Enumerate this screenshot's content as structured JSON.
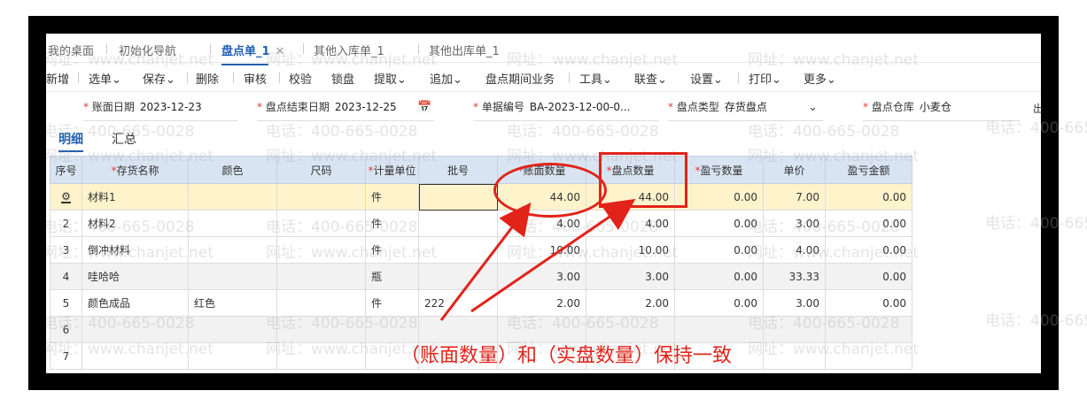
{
  "tabs": [
    {
      "label": "我的桌面"
    },
    {
      "label": "初始化导航"
    },
    {
      "label": "盘点单_1",
      "active": true
    },
    {
      "label": "其他入库单_1"
    },
    {
      "label": "其他出库单_1"
    }
  ],
  "tab_close_icon": "close-icon",
  "toolbar": [
    "新增",
    "选单⌄",
    "保存⌄",
    "删除",
    "审核",
    "校验",
    "锁盘",
    "提取⌄",
    "追加⌄",
    "盘点期间业务",
    "工具⌄",
    "联查⌄",
    "设置⌄",
    "打印⌄",
    "更多⌄"
  ],
  "form": {
    "book_date_label": "账面日期",
    "book_date_value": "2023-12-23",
    "end_date_label": "盘点结束日期",
    "end_date_value": "2023-12-25",
    "calendar_icon": "calendar-icon",
    "doc_no_label": "单据编号",
    "doc_no_value": "BA-2023-12-00-0...",
    "type_label": "盘点类型",
    "type_value": "存货盘点",
    "warehouse_label": "盘点仓库",
    "warehouse_value": "小麦仓",
    "cut_text": "出"
  },
  "detail_tabs": {
    "detail": "明细",
    "summary": "汇总"
  },
  "grid": {
    "columns": [
      "序号",
      "存货名称",
      "颜色",
      "尺码",
      "计量单位",
      "批号",
      "账面数量",
      "盘点数量",
      "盈亏数量",
      "单价",
      "盈亏金额"
    ],
    "required_columns": [
      "存货名称",
      "计量单位",
      "账面数量",
      "盘点数量",
      "盈亏数量"
    ],
    "row_settings_icon": "gear-icon",
    "rows": [
      {
        "no": "",
        "name": "材料1",
        "color": "",
        "size": "",
        "unit": "件",
        "batch": "",
        "book": "44.00",
        "count": "44.00",
        "diff": "0.00",
        "price": "7.00",
        "amount": "0.00"
      },
      {
        "no": "2",
        "name": "材料2",
        "color": "",
        "size": "",
        "unit": "件",
        "batch": "",
        "book": "4.00",
        "count": "4.00",
        "diff": "0.00",
        "price": "3.00",
        "amount": "0.00"
      },
      {
        "no": "3",
        "name": "倒冲材料",
        "color": "",
        "size": "",
        "unit": "件",
        "batch": "",
        "book": "10.00",
        "count": "10.00",
        "diff": "0.00",
        "price": "4.00",
        "amount": "0.00"
      },
      {
        "no": "4",
        "name": "哇哈哈",
        "color": "",
        "size": "",
        "unit": "瓶",
        "batch": "",
        "book": "3.00",
        "count": "3.00",
        "diff": "0.00",
        "price": "33.33",
        "amount": "0.00"
      },
      {
        "no": "5",
        "name": "颜色成品",
        "color": "红色",
        "size": "",
        "unit": "件",
        "batch": "222",
        "book": "2.00",
        "count": "2.00",
        "diff": "0.00",
        "price": "3.00",
        "amount": "0.00"
      },
      {
        "no": "6",
        "name": "",
        "color": "",
        "size": "",
        "unit": "",
        "batch": "",
        "book": "",
        "count": "",
        "diff": "",
        "price": "",
        "amount": ""
      },
      {
        "no": "7",
        "name": "",
        "color": "",
        "size": "",
        "unit": "",
        "batch": "",
        "book": "",
        "count": "",
        "diff": "",
        "price": "",
        "amount": ""
      }
    ]
  },
  "watermark": {
    "phone": "电话：400-665-0028",
    "site": "网址：www.chanjet.net"
  },
  "annotation": {
    "text": "（账面数量）和（实盘数量）保持一致",
    "color": "#e2231a"
  },
  "colors": {
    "accent": "#1f5fb0",
    "header_bg": "#d9e4f2",
    "selected_row": "#fff3cc",
    "required": "#e4393c"
  }
}
